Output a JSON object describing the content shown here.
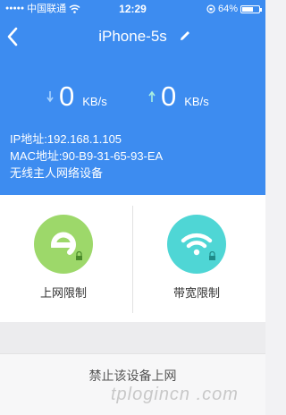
{
  "status_bar": {
    "carrier": "中国联通",
    "time": "12:29",
    "battery": "64%",
    "battery_level": 0.64
  },
  "nav": {
    "title": "iPhone-5s"
  },
  "speed": {
    "download_value": "0",
    "download_unit": "KB/s",
    "upload_value": "0",
    "upload_unit": "KB/s"
  },
  "device_info": {
    "ip": "IP地址:192.168.1.105",
    "mac": "MAC地址:90-B9-31-65-93-EA",
    "type": "无线主人网络设备"
  },
  "functions": {
    "internet_limit": "上网限制",
    "bandwidth_limit": "带宽限制"
  },
  "actions": {
    "disable_device": "禁止该设备上网"
  },
  "watermark": "tplogincn .com",
  "colors": {
    "header_blue": "#3d8cf0",
    "green_circle": "#9dd86a",
    "cyan_circle": "#4fd6d5"
  },
  "icons": [
    "back-chevron-icon",
    "edit-pencil-icon",
    "download-arrow-icon",
    "upload-arrow-icon",
    "wifi-icon",
    "lock-icon"
  ]
}
